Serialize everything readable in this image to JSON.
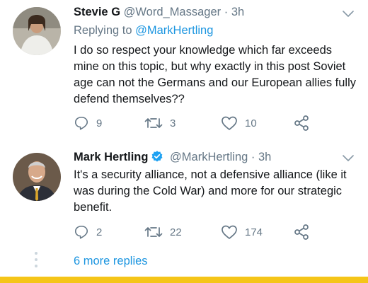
{
  "tweets": [
    {
      "name": "Stevie G",
      "handle": "@Word_Massager",
      "separator": "·",
      "time": "3h",
      "replying_prefix": "Replying to ",
      "replying_to": "@MarkHertling",
      "text": "I do so respect your knowledge which far exceeds mine on this topic, but why exactly in this post Soviet age can not the Germans and our European allies fully defend themselves??",
      "replies": "9",
      "retweets": "3",
      "likes": "10",
      "verified": false
    },
    {
      "name": "Mark Hertling",
      "handle": "@MarkHertling",
      "separator": "·",
      "time": "3h",
      "text": "It's a security alliance, not a defensive alliance (like it was during the Cold War) and more for our strategic benefit.",
      "replies": "2",
      "retweets": "22",
      "likes": "174",
      "verified": true
    }
  ],
  "more_replies": "6 more replies",
  "colors": {
    "link": "#1b95e0",
    "secondary": "#657786",
    "verified": "#1da1f2",
    "bottom_bar": "#f5c518"
  },
  "icons": [
    "chevron-down-icon",
    "reply-icon",
    "retweet-icon",
    "like-icon",
    "share-icon",
    "verified-badge-icon"
  ]
}
